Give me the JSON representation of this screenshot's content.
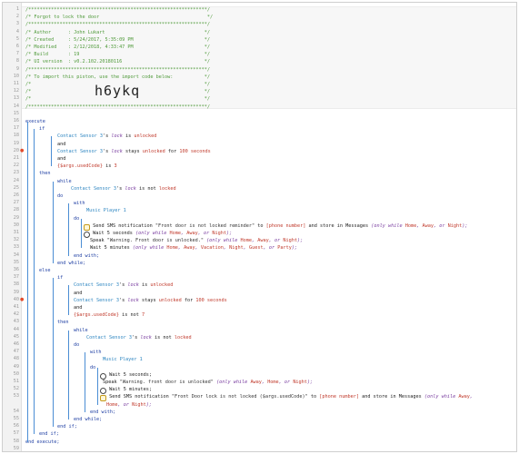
{
  "header": {
    "border_line": "/***************************************************************/",
    "title_line": "/* Forgot to lock the door                                      */",
    "author_line": "/* Author      : John Lukart                                   */",
    "created_line": "/* Created     : 5/24/2017, 5:35:09 PM                         */",
    "modified_line": "/* Modified    : 2/12/2018, 4:33:47 PM                         */",
    "build_line": "/* Build       : 19                                            */",
    "ui_line": "/* UI version  : v0.2.102.20180116                             */",
    "import_line": "/* To import this piston, use the import code below:           */",
    "blank_line": "/*                                                             */",
    "import_code": "h6ykq"
  },
  "lines": {
    "l16": "execute",
    "l17": "if",
    "l18a": "Contact Sensor 3",
    "l18b": "'s ",
    "l18c": "lock",
    "l18d": " is ",
    "l18e": "unlocked",
    "l19": "and",
    "l20a": "Contact Sensor 3",
    "l20b": "'s ",
    "l20c": "lock",
    "l20d": " stays ",
    "l20e": "unlocked",
    "l20f": " for ",
    "l20g": "100 seconds",
    "l21": "and",
    "l22a": "{$args.usedCode}",
    "l22b": " is ",
    "l22c": "3",
    "l23": "then",
    "l24": "while",
    "l25a": "Contact Sensor 3",
    "l25b": "'s ",
    "l25c": "lock",
    "l25d": " is not ",
    "l25e": "locked",
    "l26": "do",
    "l27": "with",
    "l28": "Music Player 1",
    "l29": "do",
    "l30a": " Send SMS notification ",
    "l30b": "\"Front door is not locked reminder\"",
    "l30c": " to ",
    "l30d": "[phone number]",
    "l30e": " and store in Messages ",
    "l30f": "(only while ",
    "l30g": "Home",
    "l30h": ", ",
    "l30i": "Away",
    "l30j": ", or ",
    "l30k": "Night",
    "l30l": ");",
    "l31a": " Wait 5 seconds ",
    "l31b": "(only while ",
    "l31c": "Home",
    "l31d": ", ",
    "l31e": "Away",
    "l31f": ", or ",
    "l31g": "Night",
    "l31h": ");",
    "l32a": "Speak ",
    "l32b": "\"Warning. Front door is unlocked.\"",
    "l32c": " (only while ",
    "l32d": "Home",
    "l32e": ", ",
    "l32f": "Away",
    "l32g": ", or ",
    "l32h": "Night",
    "l32i": ");",
    "l33a": "Wait 5 minutes ",
    "l33b": "(only while ",
    "l33c": "Home",
    "l33d": ", ",
    "l33e": "Away",
    "l33f": ", ",
    "l33g": "Vacation",
    "l33h": ", ",
    "l33i": "Night",
    "l33j": ", ",
    "l33k": "Guest",
    "l33l": ", or ",
    "l33m": "Party",
    "l33n": ");",
    "l34": "end with;",
    "l35": "end while;",
    "l36": "else",
    "l37": "if",
    "l38a": "Contact Sensor 3",
    "l38b": "'s ",
    "l38c": "lock",
    "l38d": " is ",
    "l38e": "unlocked",
    "l39": "and",
    "l40a": "Contact Sensor 3",
    "l40b": "'s ",
    "l40c": "lock",
    "l40d": " stays ",
    "l40e": "unlocked",
    "l40f": " for ",
    "l40g": "100 seconds",
    "l41": "and",
    "l42a": "{$args.usedCode}",
    "l42b": " is not ",
    "l42c": "7",
    "l43": "then",
    "l44": "while",
    "l45a": "Contact Sensor 3",
    "l45b": "'s ",
    "l45c": "lock",
    "l45d": " is not ",
    "l45e": "locked",
    "l46": "do",
    "l47": "with",
    "l48": "Music Player 1",
    "l49": "do",
    "l50": " Wait 5 seconds;",
    "l51a": "Speak ",
    "l51b": "\"Warning. front door is unlocked\"",
    "l51c": " (only while ",
    "l51d": "Away",
    "l51e": ", ",
    "l51f": "Home",
    "l51g": ", or ",
    "l51h": "Night",
    "l51i": ");",
    "l52": " Wait 5 minutes;",
    "l53a": " Send SMS notification ",
    "l53b": "\"Front Door lock is not locked ($args.usedCode)\"",
    "l53c": " to ",
    "l53d": "[phone number]",
    "l53e": " and store in Messages ",
    "l53f": "(only while ",
    "l53g": "Away",
    "l53h": ",",
    "l54a": "Home",
    "l54b": ", or ",
    "l54c": "Night",
    "l54d": ");",
    "l55": "end with;",
    "l56": "end while;",
    "l57": "end if;",
    "l58": "end if;",
    "l59": "end execute;"
  },
  "line_numbers": [
    "1",
    "2",
    "3",
    "4",
    "5",
    "6",
    "7",
    "8",
    "9",
    "10",
    "11",
    "12",
    "13",
    "14",
    "15",
    "16",
    "17",
    "18",
    "19",
    "20",
    "21",
    "22",
    "23",
    "24",
    "25",
    "26",
    "27",
    "28",
    "29",
    "30",
    "31",
    "32",
    "33",
    "34",
    "35",
    "36",
    "37",
    "38",
    "39",
    "40",
    "41",
    "42",
    "43",
    "44",
    "45",
    "46",
    "47",
    "48",
    "49",
    "50",
    "51",
    "52",
    "53",
    "",
    "54",
    "55",
    "56",
    "57",
    "58",
    "59"
  ],
  "colors": {
    "comment": "#4f9a3a",
    "keyword": "#1f3fa3",
    "device": "#2e86c1",
    "value": "#c0392b",
    "bracket_line": "#4b8dd4"
  }
}
